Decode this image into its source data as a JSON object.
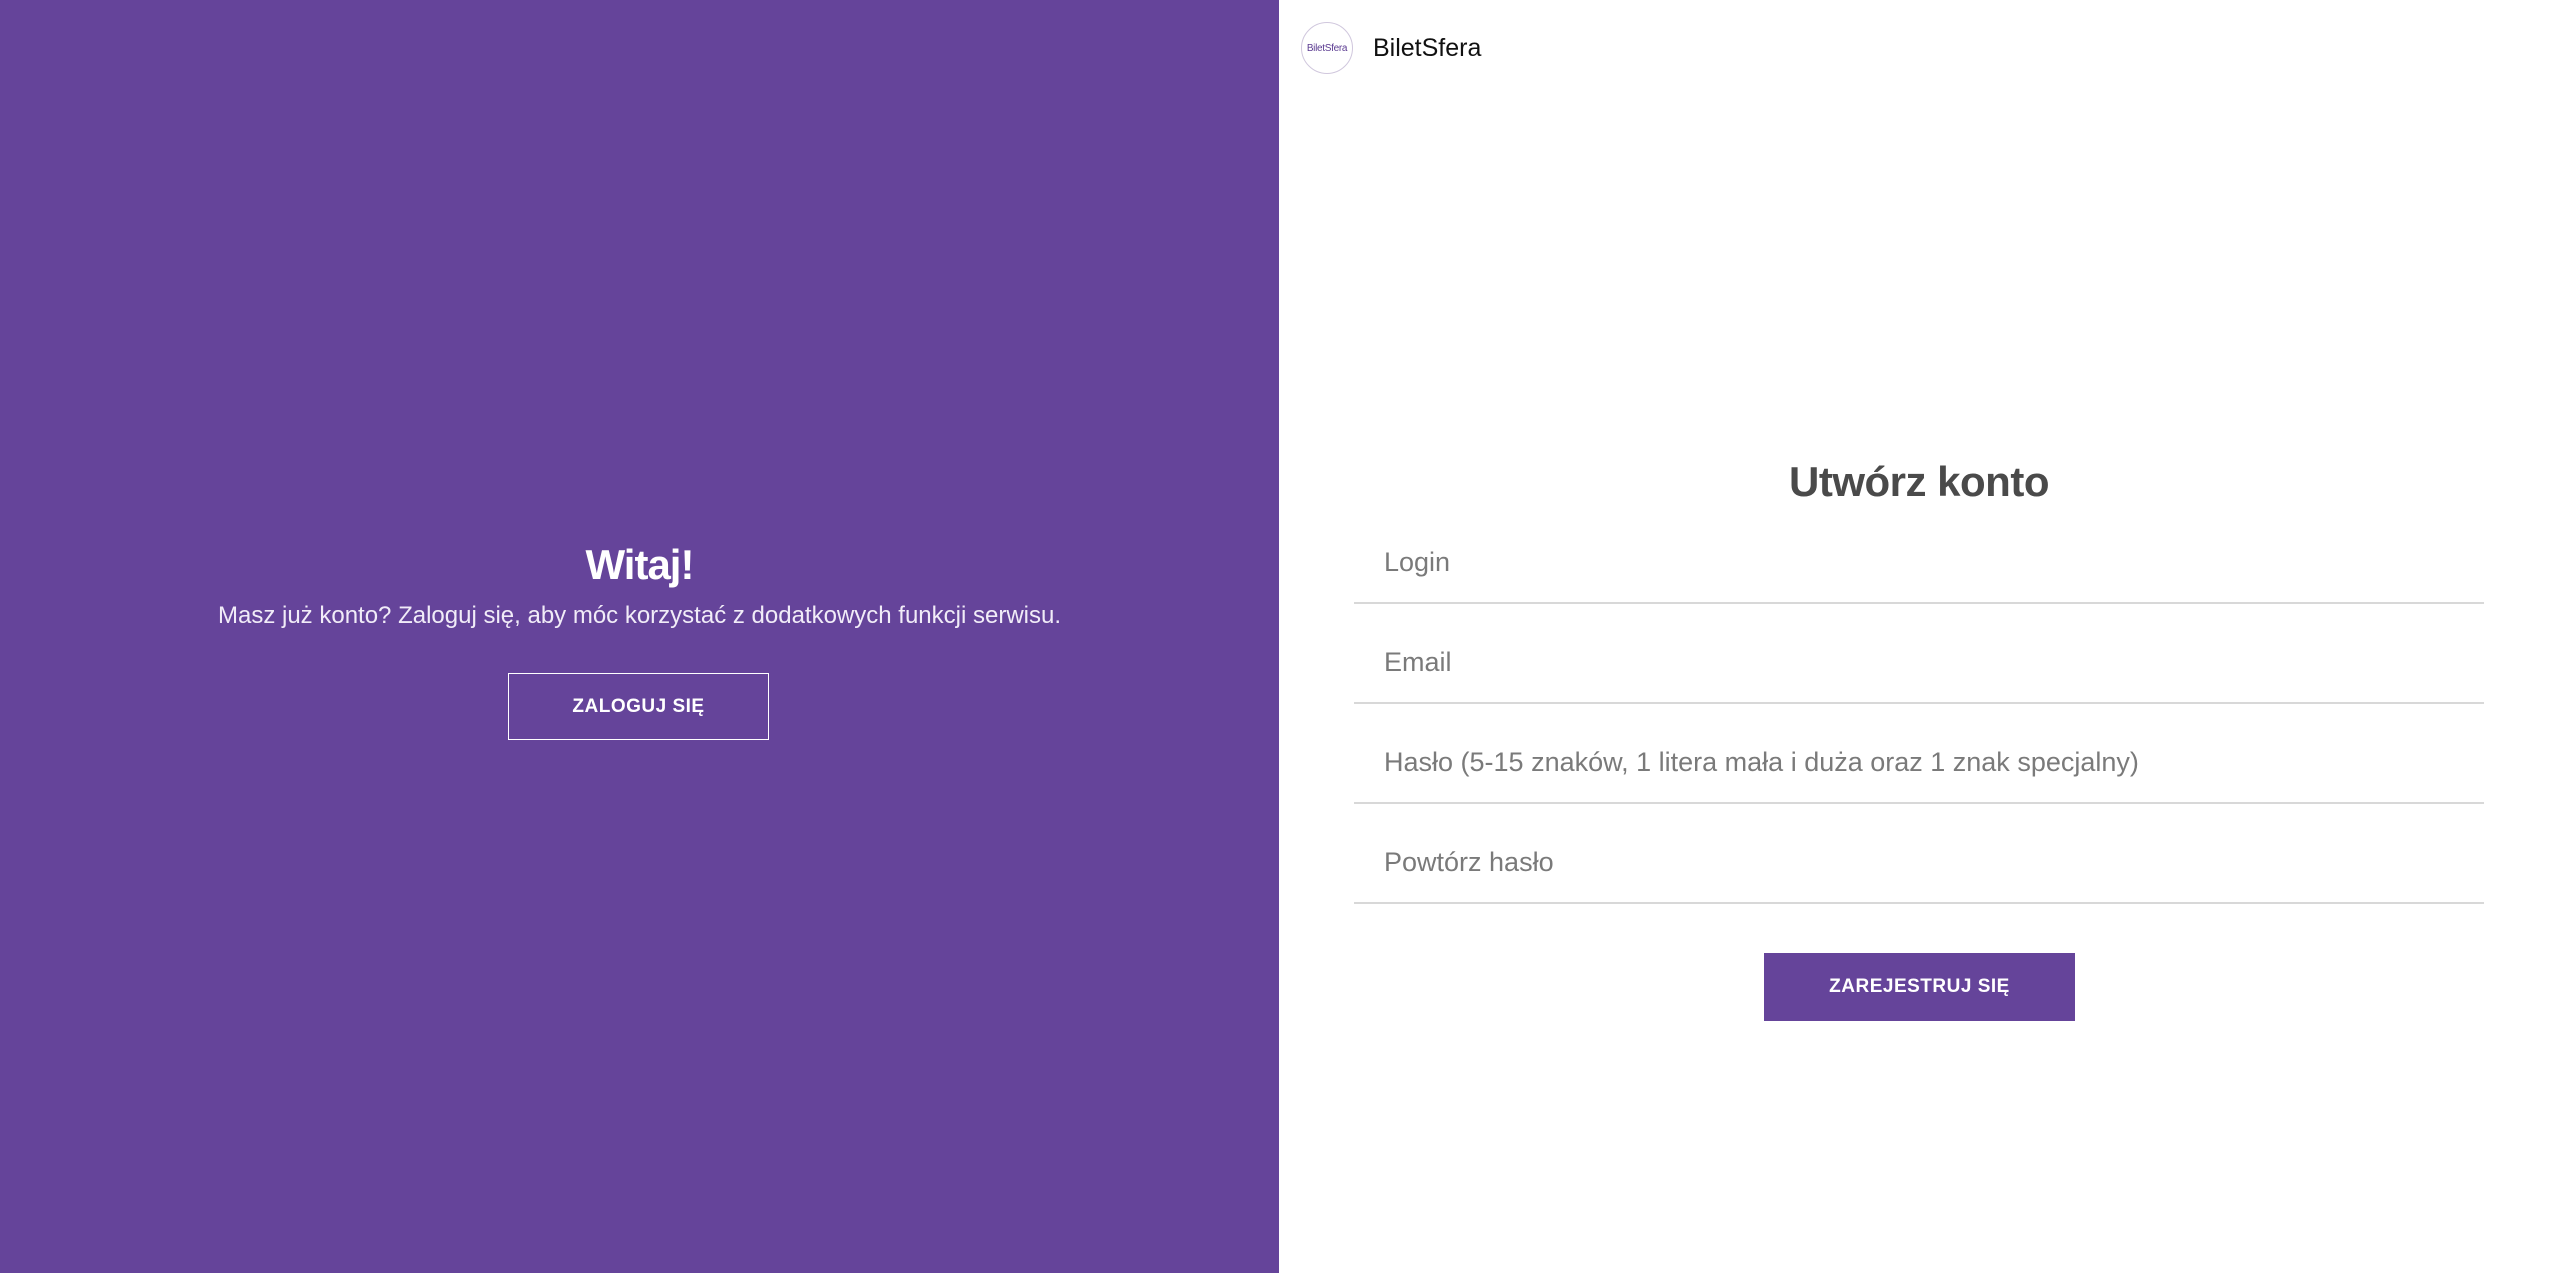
{
  "colors": {
    "primary": "#65449a",
    "background": "#ffffff",
    "title_text": "#4a4a4a",
    "placeholder_text": "#7a7a7a",
    "divider": "#d8d8d8"
  },
  "left_panel": {
    "title": "Witaj!",
    "subtitle": "Masz już konto? Zaloguj się, aby móc korzystać z dodatkowych funkcji serwisu.",
    "login_button_label": "ZALOGUJ SIĘ"
  },
  "brand": {
    "logo_text": "BiletSfera",
    "name": "BiletSfera"
  },
  "form": {
    "title": "Utwórz konto",
    "fields": {
      "login": {
        "placeholder": "Login",
        "value": ""
      },
      "email": {
        "placeholder": "Email",
        "value": ""
      },
      "password": {
        "placeholder": "Hasło (5-15 znaków, 1 litera mała i duża oraz 1 znak specjalny)",
        "value": ""
      },
      "password_repeat": {
        "placeholder": "Powtórz hasło",
        "value": ""
      }
    },
    "submit_label": "ZAREJESTRUJ SIĘ"
  }
}
